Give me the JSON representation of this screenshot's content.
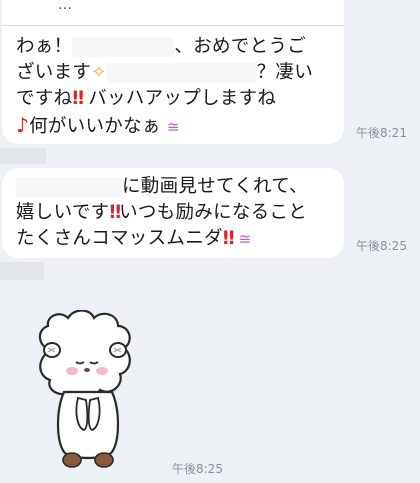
{
  "messages": [
    {
      "top_preview": "…",
      "lines": {
        "l1a": "わぁ！",
        "l1b": "、おめでとうご",
        "l2a": "ざいます",
        "l2b": "？凄い",
        "l3a": "ですね",
        "l3b": " バッハアップしますね",
        "l4a": "何がいいかなぁ"
      },
      "time": "午後8:21"
    },
    {
      "lines": {
        "l1a": "に動画見せてくれて、",
        "l2a": "嬉しいです",
        "l2b": "いつも励みになること",
        "l3a": "たくさんコマッスムニダ"
      },
      "time": "午後8:25"
    },
    {
      "sticker": "bear-bowing-sticker",
      "time": "午後8:25"
    }
  ],
  "icons": {
    "double_exclamation": "‼",
    "sparkles": "✧",
    "note": "♪",
    "smile_face": "≅"
  },
  "colors": {
    "background": "#edf0f4",
    "bubble": "#ffffff",
    "exclamation": "#e0202a",
    "time": "#8a9099"
  }
}
